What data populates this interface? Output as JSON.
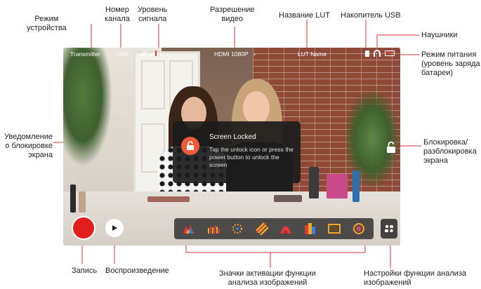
{
  "callouts": {
    "device_mode": "Режим\nустройства",
    "channel_number": "Номер\nканала",
    "signal_level": "Уровень\nсигнала",
    "video_resolution": "Разрешение\nвидео",
    "lut_name": "Название LUT",
    "usb_storage": "Накопитель USB",
    "headphones": "Наушники",
    "power_mode": "Режим питания\n(уровень заряда\nбатареи)",
    "lock_notification": "Уведомление\nо блокировке\nэкрана",
    "lock_unlock": "Блокировка/\nразблокировка\nэкрана",
    "record": "Запись",
    "playback": "Воспроизведение",
    "analysis_icons": "Значки активации функции\nанализа изображений",
    "analysis_settings": "Настройки функции анализа\nизображений"
  },
  "status_bar": {
    "mode": "Transmitter",
    "channel": "CH1",
    "resolution": "HDMI 1080P",
    "lut": "LUT Name",
    "battery_level": 0.35
  },
  "dialog": {
    "title": "Screen Locked",
    "body": "Tap the unlock icon or press the power button to unlock the screen"
  },
  "tools": [
    {
      "name": "waveform-icon"
    },
    {
      "name": "histogram-icon"
    },
    {
      "name": "focus-peaking-icon"
    },
    {
      "name": "zebra-icon"
    },
    {
      "name": "false-color-icon"
    },
    {
      "name": "rgb-parade-icon"
    },
    {
      "name": "frame-guide-icon"
    },
    {
      "name": "vectorscope-icon"
    }
  ],
  "colors": {
    "record": "#e11d1d",
    "lock_accent": "#ef5a3c",
    "callout_line": "#d83232"
  }
}
